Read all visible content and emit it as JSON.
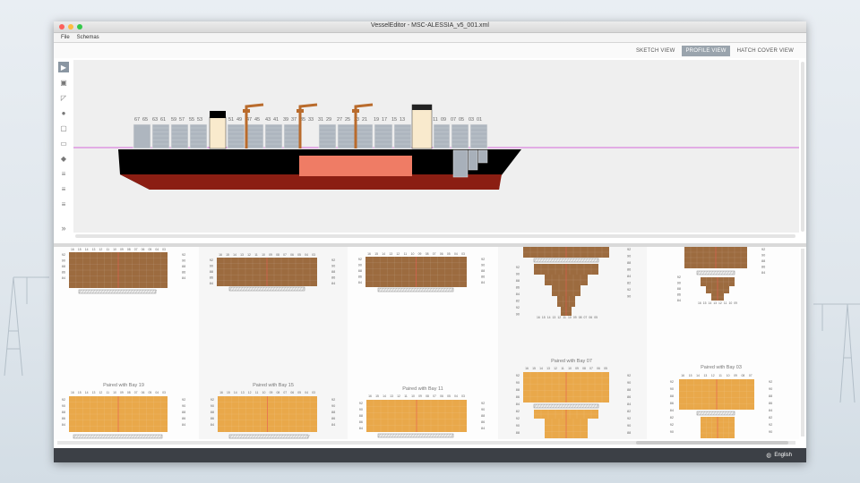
{
  "window": {
    "title": "VesselEditor - MSC-ALESSIA_v5_001.xml"
  },
  "menu": {
    "items": [
      "File",
      "Schemas"
    ]
  },
  "views": {
    "sketch": "SKETCH VIEW",
    "profile": "PROFILE VIEW",
    "hatch_cover": "HATCH COVER VIEW",
    "active": "profile"
  },
  "toolbar": {
    "tools": [
      "select-arrow-icon",
      "container-icon",
      "hatch-icon",
      "pin-icon",
      "frame-icon",
      "ruler-icon",
      "eraser-icon",
      "text-tool-icon",
      "text-tool-icon",
      "text-tool-icon"
    ],
    "expand_label": "»"
  },
  "profile": {
    "bay_labels": [
      "67",
      "65",
      "63",
      "61",
      "59",
      "57",
      "55",
      "53",
      "51",
      "49",
      "47",
      "45",
      "43",
      "41",
      "39",
      "37",
      "35",
      "33",
      "31",
      "29",
      "27",
      "25",
      "23",
      "21",
      "19",
      "17",
      "15",
      "13",
      "11",
      "09",
      "07",
      "05",
      "03",
      "01"
    ]
  },
  "bays": {
    "paired_labels": [
      "Paired with Bay 19",
      "Paired with Bay 15",
      "Paired with Bay 11",
      "Paired with Bay 07",
      "Paired with Bay 03"
    ],
    "top_tiers": [
      "92",
      "90",
      "88",
      "86",
      "84",
      "82"
    ],
    "colors": {
      "hold": "#9c6b3f",
      "deck": "#e9a84a",
      "centerline": "#e4574a",
      "hatch": "#cccccc"
    }
  },
  "status": {
    "language": "English"
  }
}
